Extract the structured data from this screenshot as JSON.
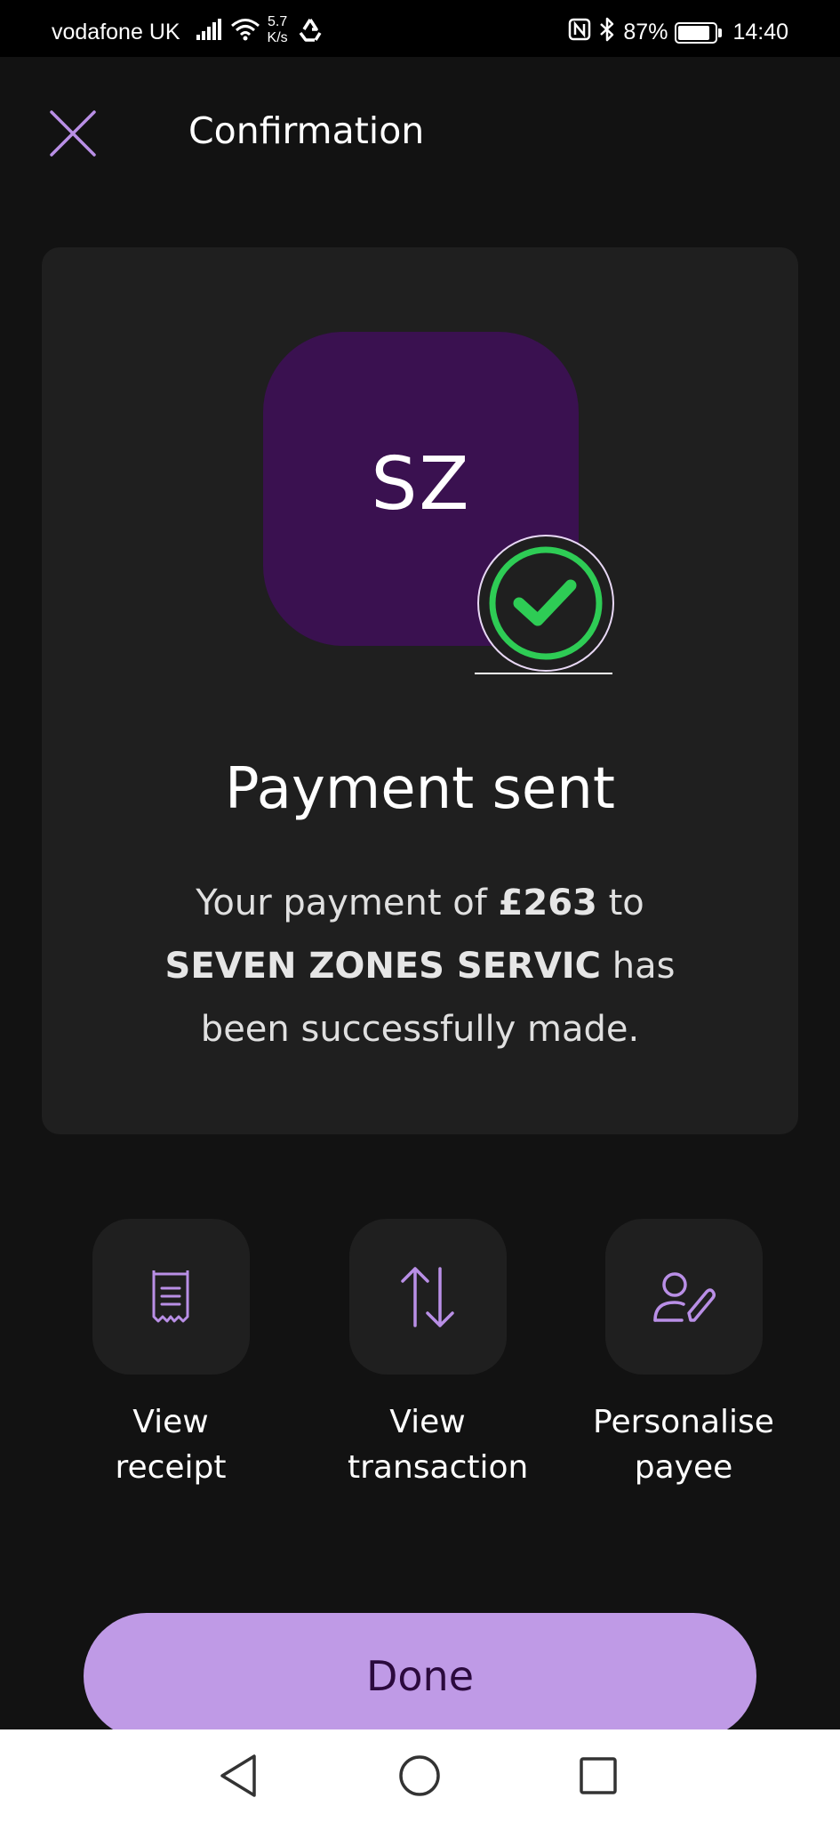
{
  "status_bar": {
    "carrier": "vodafone UK",
    "speed_value": "5.7",
    "speed_unit": "K/s",
    "battery": "87%",
    "battery_level": 0.87,
    "time": "14:40",
    "icons": [
      "signal-icon",
      "wifi-icon",
      "recycle-icon",
      "nfc-icon",
      "bluetooth-icon",
      "battery-icon"
    ]
  },
  "header": {
    "title": "Confirmation",
    "close_icon": "close-icon"
  },
  "card": {
    "initials": "SZ",
    "badge_icon": "checkmark-icon",
    "title": "Payment sent",
    "message_prefix": "Your payment of ",
    "amount": "£263",
    "message_mid": " to ",
    "payee": "SEVEN ZONES SERVIC",
    "message_suffix": " has been successfully made."
  },
  "actions": [
    {
      "line1": "View",
      "line2": "receipt",
      "icon": "receipt-icon"
    },
    {
      "line1": "View",
      "line2": "transaction",
      "icon": "transfer-arrows-icon"
    },
    {
      "line1": "Personalise",
      "line2": "payee",
      "icon": "edit-user-icon"
    }
  ],
  "done_label": "Done",
  "colors": {
    "background": "#121212",
    "card": "#1f1f1f",
    "accent": "#bf9ae6",
    "avatar": "#3a1150",
    "success": "#2ecc55"
  }
}
